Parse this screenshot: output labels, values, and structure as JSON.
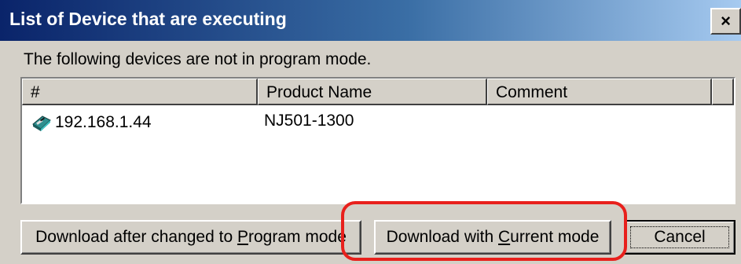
{
  "window": {
    "title": "List of Device that are executing",
    "close_label": "×"
  },
  "message": "The following devices are not in program mode.",
  "table": {
    "columns": [
      "#",
      "Product Name",
      "Comment",
      ""
    ],
    "rows": [
      {
        "icon": "plc-device-icon",
        "number": "192.168.1.44",
        "product_name": "NJ501-1300",
        "comment": ""
      }
    ]
  },
  "buttons": {
    "program_mode_prefix": "Download after changed to ",
    "program_mode_accel": "P",
    "program_mode_suffix": "rogram mode",
    "current_mode_prefix": "Download with ",
    "current_mode_accel": "C",
    "current_mode_suffix": "urrent mode",
    "cancel": "Cancel"
  },
  "colors": {
    "title_bar_start": "#0a246a",
    "title_bar_end": "#a6caf0",
    "dialog_background": "#d4d0c8",
    "highlight_annotation": "#e8201c"
  }
}
